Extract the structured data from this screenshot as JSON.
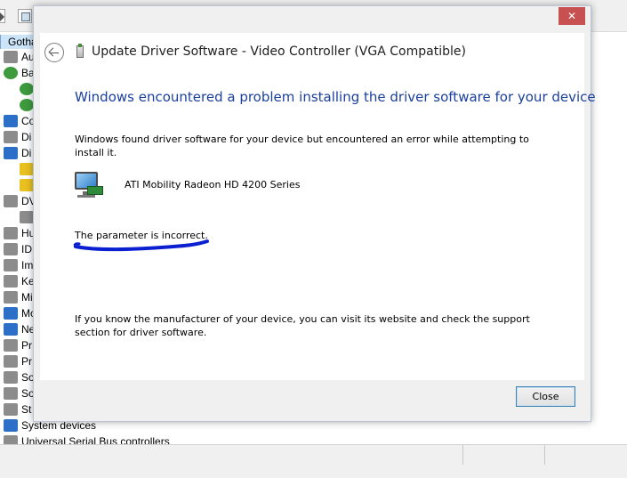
{
  "background_window": {
    "tree_root": "Gotha",
    "tree_items": [
      "Au",
      "Ba",
      "Co",
      "Di",
      "Di",
      "DV",
      "Hu",
      "ID",
      "Im",
      "Ke",
      "Mi",
      "Mo",
      "Ne",
      "Pr",
      "Pr",
      "So",
      "So",
      "St",
      "System devices",
      "Universal Serial Bus controllers"
    ]
  },
  "dialog": {
    "close_glyph": "✕",
    "title": "Update Driver Software - Video Controller (VGA Compatible)",
    "main_instruction": "Windows encountered a problem installing the driver software for your device",
    "description": "Windows found driver software for your device but encountered an error while attempting to install it.",
    "device_name": "ATI Mobility Radeon HD 4200 Series",
    "error_message": "The parameter is incorrect.",
    "footer_note": "If you know the manufacturer of your device, you can visit its website and check the support section for driver software.",
    "close_button_label": "Close"
  },
  "colors": {
    "instruction_blue": "#1a3f9e",
    "annotation_blue": "#0a1fd0",
    "close_red": "#c75050"
  }
}
